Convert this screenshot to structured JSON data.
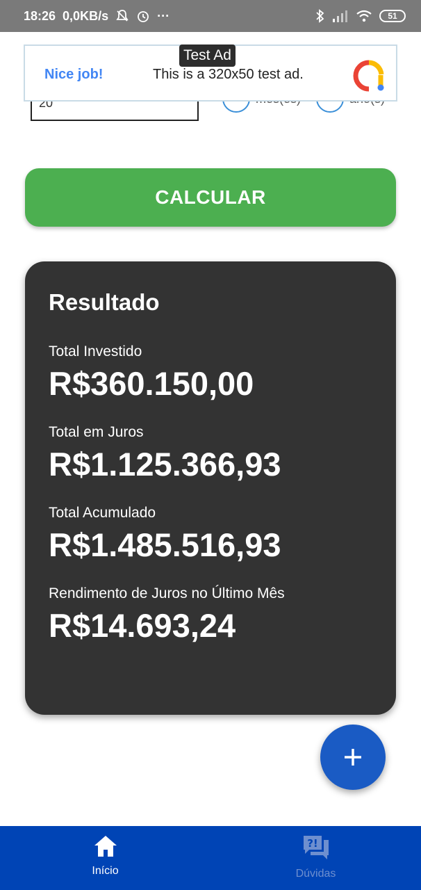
{
  "status_bar": {
    "time": "18:26",
    "speed": "0,0KB/s",
    "more": "···",
    "battery": "51",
    "icons": [
      "bell-off-icon",
      "alarm-icon",
      "bluetooth-icon",
      "signal-icon",
      "wifi-icon",
      "battery-icon"
    ]
  },
  "form": {
    "input_value": "20",
    "radio_month_label": "mês(es)",
    "radio_year_label": "ano(s)"
  },
  "ad": {
    "tag": "Test Ad",
    "nice": "Nice job!",
    "text": "This is a 320x50 test ad."
  },
  "calculate_label": "CALCULAR",
  "result": {
    "title": "Resultado",
    "items": [
      {
        "label": "Total Investido",
        "value": "R$360.150,00"
      },
      {
        "label": "Total em Juros",
        "value": "R$1.125.366,93"
      },
      {
        "label": "Total Acumulado",
        "value": "R$1.485.516,93"
      },
      {
        "label": "Rendimento de Juros no Último Mês",
        "value": "R$14.693,24"
      }
    ]
  },
  "nav": {
    "home": "Início",
    "faq": "Dúvidas"
  },
  "colors": {
    "accent_green": "#4caf50",
    "card_bg": "#333333",
    "nav_bg": "#0044b5",
    "fab_bg": "#1a5bc4"
  }
}
